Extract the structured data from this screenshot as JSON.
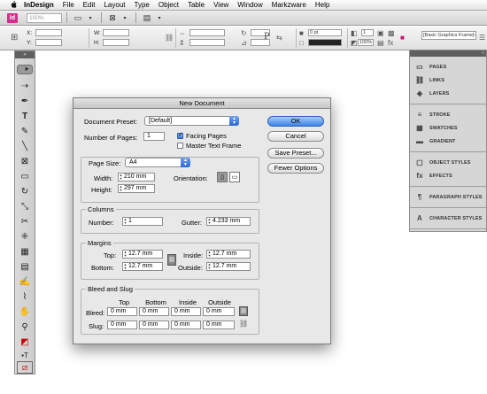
{
  "menubar": {
    "apple": "",
    "items": [
      "InDesign",
      "File",
      "Edit",
      "Layout",
      "Type",
      "Object",
      "Table",
      "View",
      "Window",
      "Markzware",
      "Help"
    ]
  },
  "appbar": {
    "logo": "Id",
    "zoom": "100%"
  },
  "ctrl": {
    "x_label": "X:",
    "y_label": "Y:",
    "w_label": "W:",
    "h_label": "H:",
    "stroke_value": "0 pt",
    "pct_value": "100%",
    "num_value": "1",
    "style_field": "[Basic Graphics Frame]+"
  },
  "panels": {
    "header": "«",
    "groups": [
      [
        {
          "icon": "page-icon",
          "glyph": "▭",
          "label": "PAGES"
        },
        {
          "icon": "links-icon",
          "glyph": "⛓",
          "label": "LINKS"
        },
        {
          "icon": "layers-icon",
          "glyph": "◈",
          "label": "LAYERS"
        }
      ],
      [
        {
          "icon": "stroke-icon",
          "glyph": "≡",
          "label": "STROKE"
        },
        {
          "icon": "swatches-icon",
          "glyph": "▦",
          "label": "SWATCHES"
        },
        {
          "icon": "gradient-icon",
          "glyph": "▬",
          "label": "GRADIENT"
        }
      ],
      [
        {
          "icon": "object-styles-icon",
          "glyph": "▢",
          "label": "OBJECT STYLES"
        },
        {
          "icon": "effects-icon",
          "glyph": "fx",
          "label": "EFFECTS"
        }
      ],
      [
        {
          "icon": "paragraph-styles-icon",
          "glyph": "¶",
          "label": "PARAGRAPH STYLES"
        }
      ],
      [
        {
          "icon": "character-styles-icon",
          "glyph": "A",
          "label": "CHARACTER STYLES"
        }
      ]
    ]
  },
  "dialog": {
    "title": "New Document",
    "preset_label": "Document Preset:",
    "preset_value": "[Default]",
    "pages_label": "Number of Pages:",
    "pages_value": "1",
    "facing_label": "Facing Pages",
    "facing_checked": true,
    "master_label": "Master Text Frame",
    "master_checked": false,
    "pagesize_label": "Page Size:",
    "pagesize_value": "A4",
    "width_label": "Width:",
    "width_value": "210 mm",
    "height_label": "Height:",
    "height_value": "297 mm",
    "orientation_label": "Orientation:",
    "columns_title": "Columns",
    "number_label": "Number:",
    "number_value": "1",
    "gutter_label": "Gutter:",
    "gutter_value": "4.233 mm",
    "margins_title": "Margins",
    "top_label": "Top:",
    "top_value": "12.7 mm",
    "bottom_label": "Bottom:",
    "bottom_value": "12.7 mm",
    "inside_label": "Inside:",
    "inside_value": "12.7 mm",
    "outside_label": "Outside:",
    "outside_value": "12.7 mm",
    "bleed_title": "Bleed and Slug",
    "col_top": "Top",
    "col_bottom": "Bottom",
    "col_inside": "Inside",
    "col_outside": "Outside",
    "bleed_label": "Bleed:",
    "slug_label": "Slug:",
    "bleed_values": [
      "0 mm",
      "0 mm",
      "0 mm",
      "0 mm"
    ],
    "slug_values": [
      "0 mm",
      "0 mm",
      "0 mm",
      "0 mm"
    ],
    "buttons": {
      "ok": "OK",
      "cancel": "Cancel",
      "save_preset": "Save Preset...",
      "fewer": "Fewer Options"
    }
  }
}
